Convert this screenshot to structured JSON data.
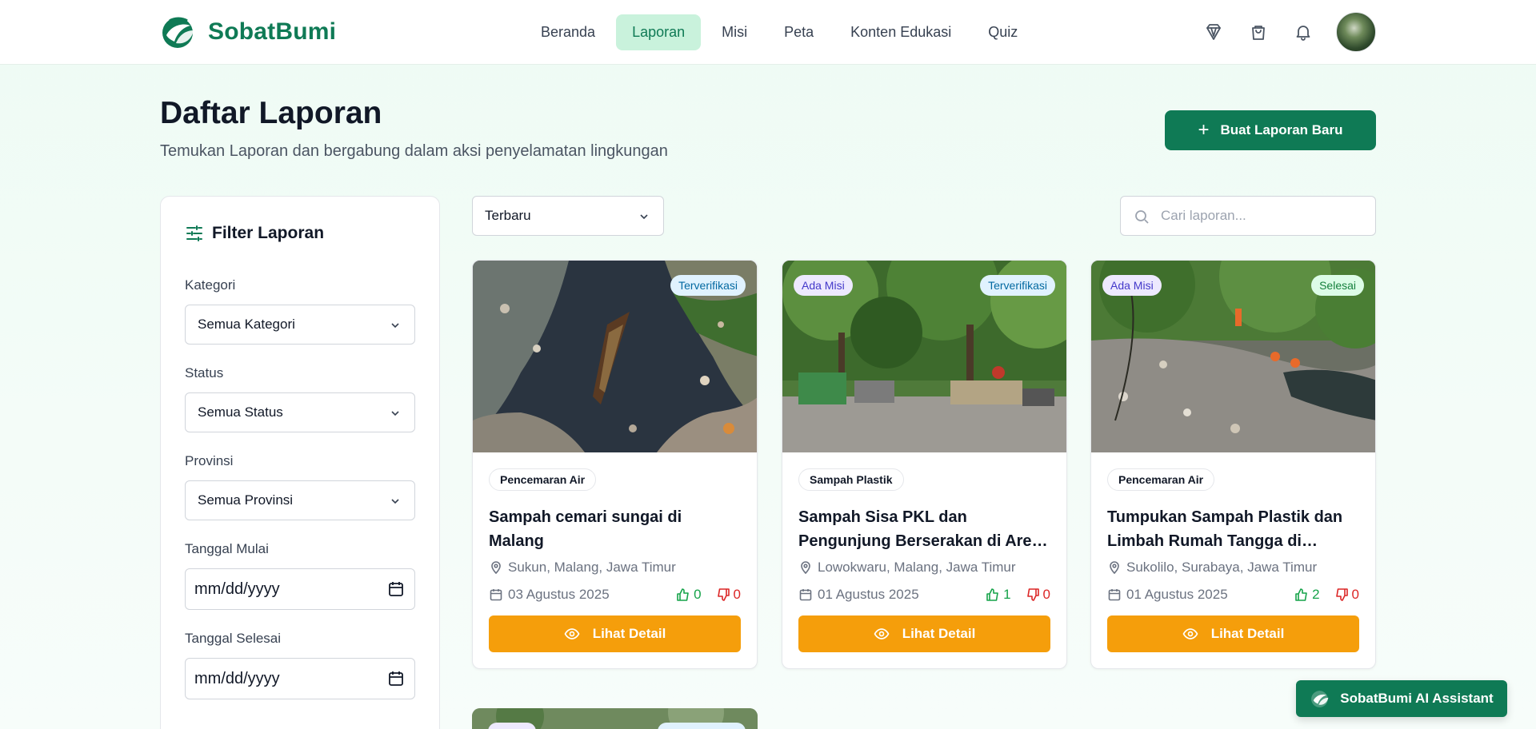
{
  "brand": {
    "name": "SobatBumi"
  },
  "nav": [
    {
      "label": "Beranda"
    },
    {
      "label": "Laporan"
    },
    {
      "label": "Misi"
    },
    {
      "label": "Peta"
    },
    {
      "label": "Konten Edukasi"
    },
    {
      "label": "Quiz"
    }
  ],
  "page": {
    "title": "Daftar Laporan",
    "subtitle": "Temukan Laporan dan bergabung dalam aksi penyelamatan lingkungan",
    "new_report_label": "Buat Laporan Baru"
  },
  "filter": {
    "title": "Filter Laporan",
    "category_label": "Kategori",
    "category_value": "Semua Kategori",
    "status_label": "Status",
    "status_value": "Semua Status",
    "province_label": "Provinsi",
    "province_value": "Semua Provinsi",
    "start_label": "Tanggal Mulai",
    "start_placeholder": "mm/dd/yyyy",
    "end_label": "Tanggal Selesai",
    "end_placeholder": "mm/dd/yyyy"
  },
  "toolbar": {
    "sort_value": "Terbaru",
    "search_placeholder": "Cari laporan..."
  },
  "cards": [
    {
      "badges": {
        "right": "Terverifikasi"
      },
      "category": "Pencemaran Air",
      "title": "Sampah cemari sungai di Malang",
      "location": "Sukun, Malang, Jawa Timur",
      "date": "03 Agustus 2025",
      "likes": "0",
      "dislikes": "0",
      "button": "Lihat Detail"
    },
    {
      "badges": {
        "left": "Ada Misi",
        "right": "Terverifikasi"
      },
      "category": "Sampah Plastik",
      "title": "Sampah Sisa PKL dan Pengunjung Berserakan di Area Taman...",
      "location": "Lowokwaru, Malang, Jawa Timur",
      "date": "01 Agustus 2025",
      "likes": "1",
      "dislikes": "0",
      "button": "Lihat Detail"
    },
    {
      "badges": {
        "left": "Ada Misi",
        "right": "Selesai"
      },
      "category": "Pencemaran Air",
      "title": "Tumpukan Sampah Plastik dan Limbah Rumah Tangga di Pinggir...",
      "location": "Sukolilo, Surabaya, Jawa Timur",
      "date": "01 Agustus 2025",
      "likes": "2",
      "dislikes": "0",
      "button": "Lihat Detail"
    }
  ],
  "assistant": {
    "label": "SobatBumi AI Assistant"
  },
  "colors": {
    "primary": "#0f7a55",
    "accent": "#f59e0b",
    "active_nav_bg": "#c9f2dc"
  }
}
